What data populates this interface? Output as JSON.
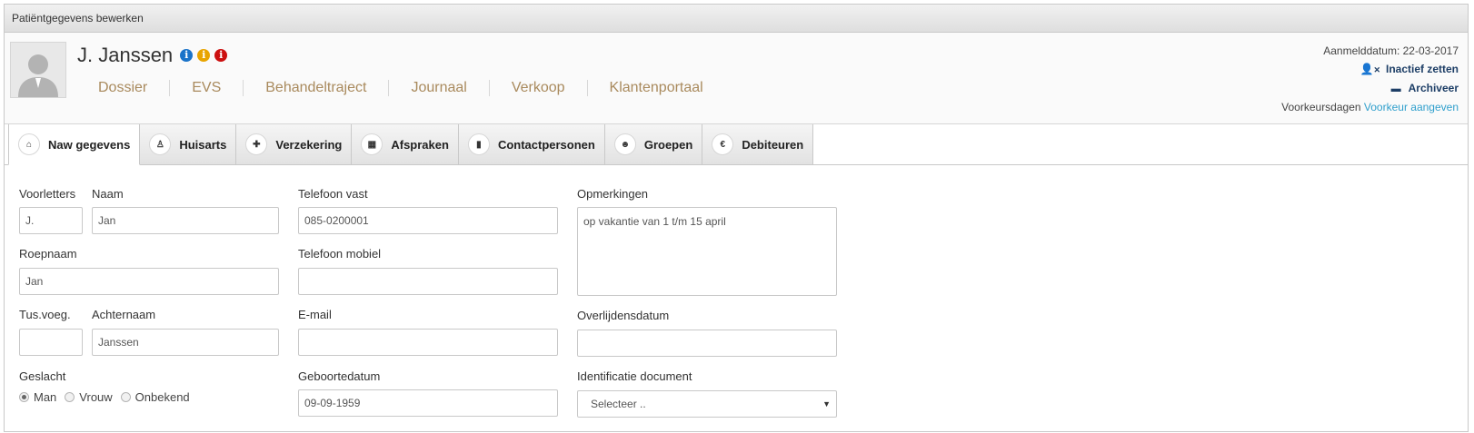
{
  "window": {
    "title": "Patiëntgegevens bewerken"
  },
  "patient": {
    "name": "J. Janssen"
  },
  "info_icons": [
    {
      "name": "info-blue-icon",
      "glyph": "i",
      "color": "#1a73c9"
    },
    {
      "name": "info-orange-icon",
      "glyph": "i",
      "color": "#e8a400"
    },
    {
      "name": "info-red-icon",
      "glyph": "i",
      "color": "#cc1010"
    }
  ],
  "nav": [
    "Dossier",
    "EVS",
    "Behandeltraject",
    "Journaal",
    "Verkoop",
    "Klantenportaal"
  ],
  "header_right": {
    "aanmelddatum": "Aanmelddatum: 22-03-2017",
    "inactief": "Inactief zetten",
    "archiveer": "Archiveer",
    "voorkeursdagen_label": "Voorkeursdagen",
    "voorkeur_link": "Voorkeur aangeven"
  },
  "tabs": [
    {
      "label": "Naw gegevens",
      "icon": "home-icon",
      "glyph": "⌂",
      "active": true
    },
    {
      "label": "Huisarts",
      "icon": "doctor-icon",
      "glyph": "♙",
      "active": false
    },
    {
      "label": "Verzekering",
      "icon": "plus-square-icon",
      "glyph": "✚",
      "active": false
    },
    {
      "label": "Afspraken",
      "icon": "calendar-icon",
      "glyph": "▦",
      "active": false
    },
    {
      "label": "Contactpersonen",
      "icon": "contact-book-icon",
      "glyph": "▮",
      "active": false
    },
    {
      "label": "Groepen",
      "icon": "users-icon",
      "glyph": "☻",
      "active": false
    },
    {
      "label": "Debiteuren",
      "icon": "euro-icon",
      "glyph": "€",
      "active": false
    }
  ],
  "form": {
    "voorletters": {
      "label": "Voorletters",
      "value": "J."
    },
    "naam": {
      "label": "Naam",
      "value": "Jan"
    },
    "roepnaam": {
      "label": "Roepnaam",
      "value": "Jan"
    },
    "tusvoeg": {
      "label": "Tus.voeg.",
      "value": ""
    },
    "achternaam": {
      "label": "Achternaam",
      "value": "Janssen"
    },
    "geslacht": {
      "label": "Geslacht",
      "options": [
        "Man",
        "Vrouw",
        "Onbekend"
      ],
      "selected": "Man"
    },
    "telefoon_vast": {
      "label": "Telefoon vast",
      "value": "085-0200001"
    },
    "telefoon_mobiel": {
      "label": "Telefoon mobiel",
      "value": ""
    },
    "email": {
      "label": "E-mail",
      "value": ""
    },
    "geboortedatum": {
      "label": "Geboortedatum",
      "value": "09-09-1959"
    },
    "opmerkingen": {
      "label": "Opmerkingen",
      "value": "op vakantie van 1 t/m 15 april"
    },
    "overlijdensdatum": {
      "label": "Overlijdensdatum",
      "value": ""
    },
    "identificatie": {
      "label": "Identificatie document",
      "selected": "Selecteer .."
    }
  }
}
